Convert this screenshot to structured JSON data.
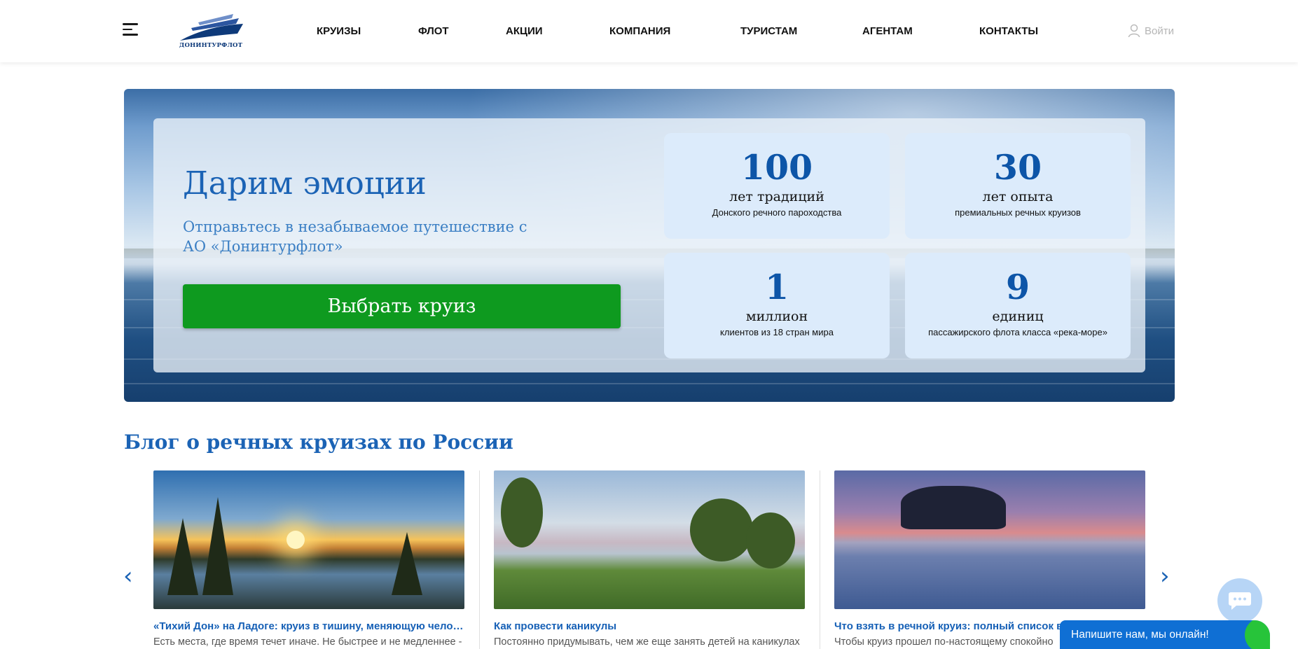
{
  "header": {
    "logo_text": "ДОНИНТУРФЛОТ",
    "nav": [
      "КРУИЗЫ",
      "ФЛОТ",
      "АКЦИИ",
      "КОМПАНИЯ",
      "ТУРИСТАМ",
      "АГЕНТАМ",
      "КОНТАКТЫ"
    ],
    "login_label": "Войти",
    "icons": [
      "burger-menu-icon",
      "user-icon"
    ]
  },
  "hero": {
    "title": "Дарим эмоции",
    "subtitle": "Отправьтесь в незабываемое путешествие с АО «Донинтурфлот»",
    "button": "Выбрать круиз",
    "stats": [
      {
        "num": "100",
        "unit": "лет традиций",
        "desc": "Донского речного пароходства"
      },
      {
        "num": "30",
        "unit": "лет опыта",
        "desc": "премиальных речных круизов"
      },
      {
        "num": "1",
        "unit": "миллион",
        "desc": "клиентов из 18 стран мира"
      },
      {
        "num": "9",
        "unit": "единиц",
        "desc": "пассажирского флота класса «река-море»"
      }
    ]
  },
  "blog": {
    "title": "Блог о речных круизах по России",
    "prev_icon": "‹",
    "next_icon": "›",
    "cards": [
      {
        "link": "«Тихий Дон» на Ладоге: круиз в тишину, меняющую человека",
        "text": "Есть места, где время течет иначе. Не быстрее и не медленнее -"
      },
      {
        "link": "Как провести каникулы",
        "text": "Постоянно придумывать, чем же еще занять детей на каникулах"
      },
      {
        "link": "Что взять в речной круиз: полный список вещей",
        "text": "Чтобы круиз прошел по-настоящему спокойно"
      }
    ]
  },
  "chat": {
    "label": "Напишите нам, мы онлайн!"
  },
  "colors": {
    "brand_blue": "#1b63b5",
    "button_green": "#0e9a1f",
    "stat_bg": "#dcebfb",
    "chat_blue": "#0f6fd4"
  }
}
